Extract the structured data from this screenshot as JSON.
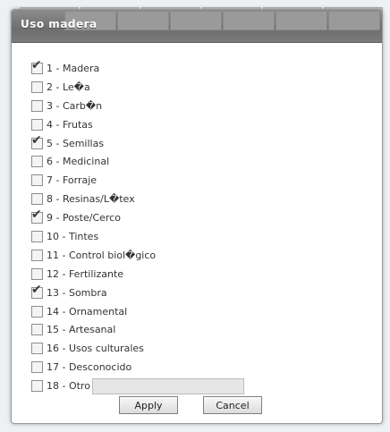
{
  "dialog": {
    "title": "Uso madera",
    "apply_label": "Apply",
    "cancel_label": "Cancel",
    "items": [
      {
        "label": "1 - Madera",
        "checked": true
      },
      {
        "label": "2 - Le�a",
        "checked": false
      },
      {
        "label": "3 - Carb�n",
        "checked": false
      },
      {
        "label": "4 - Frutas",
        "checked": false
      },
      {
        "label": "5 - Semillas",
        "checked": true
      },
      {
        "label": "6 - Medicinal",
        "checked": false
      },
      {
        "label": "7 - Forraje",
        "checked": false
      },
      {
        "label": "8 - Resinas/L�tex",
        "checked": false
      },
      {
        "label": "9 - Poste/Cerco",
        "checked": true
      },
      {
        "label": "10 - Tintes",
        "checked": false
      },
      {
        "label": "11 - Control biol�gico",
        "checked": false
      },
      {
        "label": "12 - Fertilizante",
        "checked": false
      },
      {
        "label": "13 - Sombra",
        "checked": true
      },
      {
        "label": "14 - Ornamental",
        "checked": false
      },
      {
        "label": "15 - Artesanal",
        "checked": false
      },
      {
        "label": "16 - Usos culturales",
        "checked": false
      },
      {
        "label": "17 - Desconocido",
        "checked": false
      },
      {
        "label": "18 - Otro",
        "checked": false,
        "other_value": ""
      }
    ]
  },
  "icons": {
    "checkmark": "checkmark-icon"
  },
  "colors": {
    "titlebar": "#7a7a7a",
    "background": "#eef1f3"
  }
}
